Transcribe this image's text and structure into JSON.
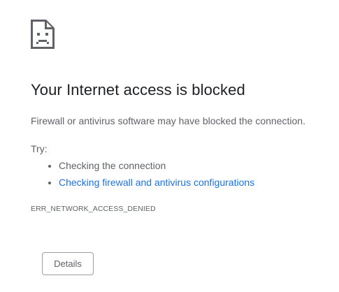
{
  "icon": {
    "name": "sad-page-icon"
  },
  "error_page": {
    "heading": "Your Internet access is blocked",
    "summary": "Firewall or antivirus software may have blocked the connection.",
    "try_label": "Try:",
    "suggestions": [
      {
        "text": "Checking the connection",
        "is_link": false
      },
      {
        "text": "Checking firewall and antivirus configurations",
        "is_link": true
      }
    ],
    "error_code": "ERR_NETWORK_ACCESS_DENIED",
    "details_button_label": "Details"
  },
  "colors": {
    "heading": "#202124",
    "body_text": "#5f6368",
    "link": "#1a73e8",
    "button_border": "#9aa0a6"
  }
}
